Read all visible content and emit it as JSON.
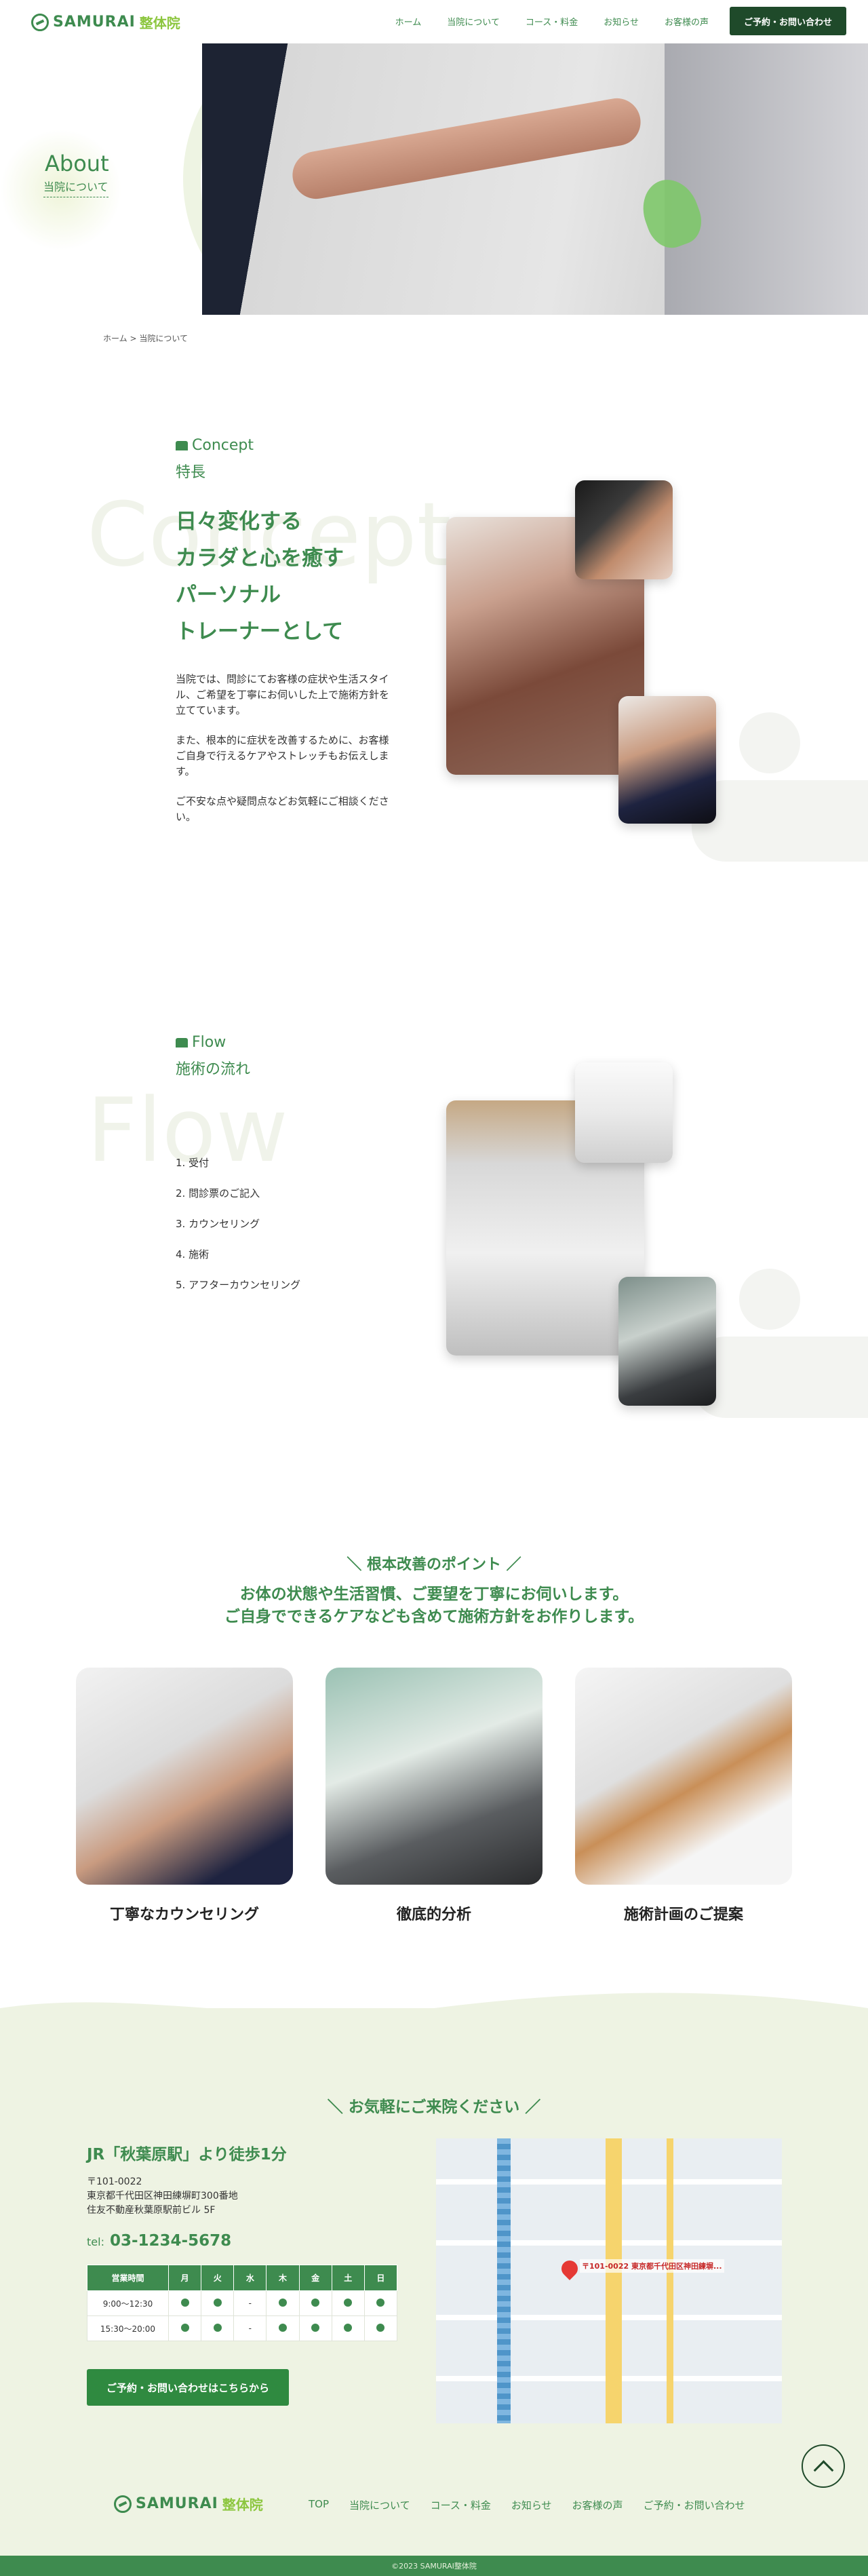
{
  "brand": {
    "name": "SAMURAI",
    "sub": "整体院"
  },
  "nav": [
    "ホーム",
    "当院について",
    "コース・料金",
    "お知らせ",
    "お客様の声"
  ],
  "header_cta": "ご予約・お問い合わせ",
  "hero": {
    "title": "About",
    "subtitle": "当院について"
  },
  "breadcrumb": "ホーム > 当院について",
  "concept": {
    "label": "Concept",
    "label_jp": "特長",
    "bg_word": "Concept",
    "headline": [
      "日々変化する",
      "カラダと心を癒す",
      "パーソナル",
      "トレーナーとして"
    ],
    "paragraphs": [
      "当院では、問診にてお客様の症状や生活スタイル、ご希望を丁寧にお伺いした上で施術方針を立てています。",
      "また、根本的に症状を改善するために、お客様ご自身で行えるケアやストレッチもお伝えします。",
      "ご不安な点や疑問点などお気軽にご相談ください。"
    ]
  },
  "flow": {
    "label": "Flow",
    "label_jp": "施術の流れ",
    "bg_word": "Flow",
    "steps": [
      "1. 受付",
      "2. 問診票のご記入",
      "3. カウンセリング",
      "4. 施術",
      "5. アフターカウンセリング"
    ]
  },
  "points": {
    "title": "根本改善のポイント",
    "lead": [
      "お体の状態や生活習慣、ご要望を丁寧にお伺いします。",
      "ご自身でできるケアなども含めて施術方針をお作りします。"
    ],
    "cards": [
      "丁寧なカウンセリング",
      "徹底的分析",
      "施術計画のご提案"
    ]
  },
  "contact": {
    "title": "お気軽にご来院ください",
    "access": "JR「秋葉原駅」より徒歩1分",
    "address": [
      "〒101-0022",
      "東京都千代田区神田練塀町300番地",
      "住友不動産秋葉原駅前ビル 5F"
    ],
    "tel_label": "tel:",
    "tel": "03-1234-5678",
    "hours_headers": [
      "営業時間",
      "月",
      "火",
      "水",
      "木",
      "金",
      "土",
      "日"
    ],
    "hours_rows": [
      {
        "time": "9:00〜12:30",
        "days": [
          "●",
          "●",
          "-",
          "●",
          "●",
          "●",
          "●"
        ]
      },
      {
        "time": "15:30〜20:00",
        "days": [
          "●",
          "●",
          "-",
          "●",
          "●",
          "●",
          "●"
        ]
      }
    ],
    "button": "ご予約・お問い合わせはこちらから",
    "map_pin_label": "〒101-0022 東京都千代田区神田練塀..."
  },
  "footer": {
    "nav": [
      "TOP",
      "当院について",
      "コース・料金",
      "お知らせ",
      "お客様の声",
      "ご予約・お問い合わせ"
    ],
    "copyright": "©2023 SAMURAI整体院"
  },
  "colors": {
    "accent": "#3e8b4f",
    "dark": "#1f4a2a",
    "lime": "#8cc63e",
    "contact_bg": "#eef3e3"
  }
}
